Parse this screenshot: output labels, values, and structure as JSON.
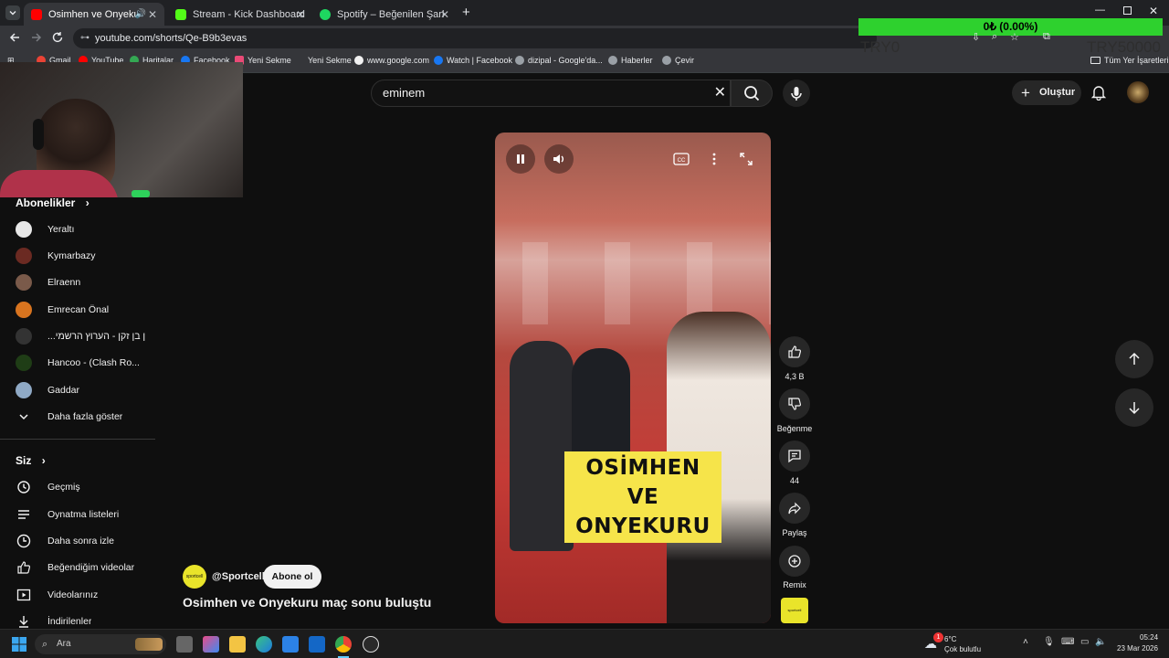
{
  "browser": {
    "tabs": [
      {
        "title": "Osimhen ve Onyekuru maç",
        "active": true,
        "favicon_color": "#ff0000"
      },
      {
        "title": "Stream - Kick Dashboard",
        "active": false,
        "favicon_color": "#53fc18"
      },
      {
        "title": "Spotify – Beğenilen Şarkılar",
        "active": false,
        "favicon_color": "#1ed760"
      }
    ],
    "url": "youtube.com/shorts/Qe-B9b3evas",
    "bookmarks": [
      "Gmail",
      "YouTube",
      "Haritalar",
      "Facebook",
      "Yeni Sekme",
      "Yeni Sekme",
      "www.google.com",
      "Watch | Facebook",
      "dizipal - Google'da...",
      "Haberler",
      "Çevir"
    ],
    "all_bookmarks": "Tüm Yer İşaretleri"
  },
  "overlay": {
    "goal_text": "0₺ (0.00%)",
    "ghost_left": "TRY0",
    "ghost_right": "TRY50000"
  },
  "youtube": {
    "search_value": "eminem",
    "create_label": "Oluştur",
    "subscriptions_heading": "Abonelikler",
    "subscriptions": [
      {
        "name": "Yeraltı",
        "color": "#e8e8e8"
      },
      {
        "name": "Kymarbazy",
        "color": "#6b2a22"
      },
      {
        "name": "Elraenn",
        "color": "#7a5a4a"
      },
      {
        "name": "Emrecan Önal",
        "color": "#d8741f"
      },
      {
        "name": "...ן בן זקן - הערוץ הרשמי",
        "color": "#333333"
      },
      {
        "name": "Hancoo - (Clash Ro...",
        "color": "#1f3d16"
      },
      {
        "name": "Gaddar",
        "color": "#8fa9c5"
      }
    ],
    "show_more": "Daha fazla göster",
    "you_heading": "Siz",
    "you_items": [
      "Geçmiş",
      "Oynatma listeleri",
      "Daha sonra izle",
      "Beğendiğim videolar",
      "Videolarınız",
      "İndirilenler"
    ],
    "video_caption_line1": "OSİMHEN VE",
    "video_caption_line2": "ONYEKURU",
    "actions": {
      "like_count": "4,3 B",
      "dislike_label": "Beğenme",
      "comment_count": "44",
      "share_label": "Paylaş",
      "remix_label": "Remix"
    },
    "channel_handle": "@Sportcell",
    "subscribe_label": "Abone ol",
    "video_title": "Osimhen ve Onyekuru maç sonu buluştu",
    "channel_avatar_text": "sportcell"
  },
  "taskbar": {
    "search_placeholder": "Ara",
    "weather_temp": "6°C",
    "weather_desc": "Çok bulutlu",
    "time": "05:24",
    "date": "23 Mar 2026",
    "notification_count": "1"
  }
}
